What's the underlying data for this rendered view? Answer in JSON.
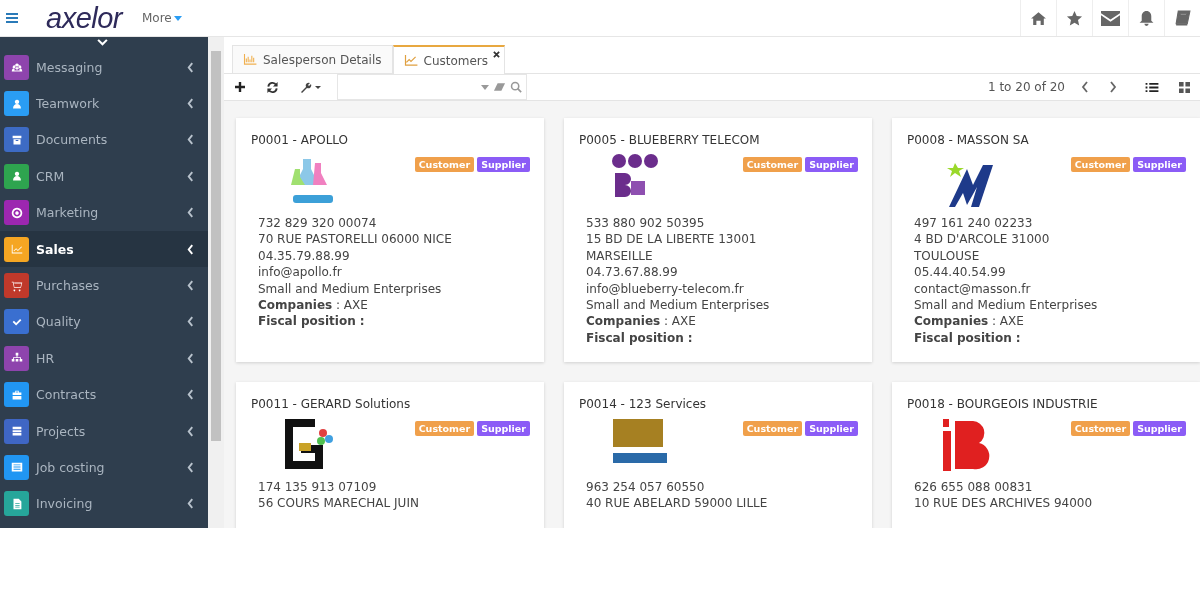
{
  "header": {
    "logo": "axelor",
    "more_menu": "More"
  },
  "sidebar": {
    "items": [
      {
        "label": "Messaging",
        "color": "#8e44ad",
        "selected": false
      },
      {
        "label": "Teamwork",
        "color": "#2a9df4",
        "selected": false
      },
      {
        "label": "Documents",
        "color": "#3d6bc4",
        "selected": false
      },
      {
        "label": "CRM",
        "color": "#2ea44f",
        "selected": false
      },
      {
        "label": "Marketing",
        "color": "#9c27b0",
        "selected": false
      },
      {
        "label": "Sales",
        "color": "#f5a623",
        "selected": true
      },
      {
        "label": "Purchases",
        "color": "#c0392b",
        "selected": false
      },
      {
        "label": "Quality",
        "color": "#3a6fd0",
        "selected": false
      },
      {
        "label": "HR",
        "color": "#8e44ad",
        "selected": false
      },
      {
        "label": "Contracts",
        "color": "#2196f3",
        "selected": false
      },
      {
        "label": "Projects",
        "color": "#3f66c4",
        "selected": false
      },
      {
        "label": "Job costing",
        "color": "#2196f3",
        "selected": false
      },
      {
        "label": "Invoicing",
        "color": "#26a69a",
        "selected": false
      }
    ]
  },
  "tabs": [
    {
      "label": "Salesperson Details",
      "selected": false
    },
    {
      "label": "Customers",
      "selected": true
    }
  ],
  "toolbar": {
    "pager": "1 to 20 of 20"
  },
  "cards": [
    {
      "title": "P0001 - APOLLO",
      "tags": [
        {
          "label": "Customer",
          "color": "#f0a04b"
        },
        {
          "label": "Supplier",
          "color": "#8b5cf6"
        }
      ],
      "lines": [
        "732 829 320 00074",
        "70 RUE PASTORELLI 06000 NICE",
        "04.35.79.88.99",
        "info@apollo.fr",
        "Small and Medium Enterprises",
        "**Companies** : AXE",
        "**Fiscal position :**"
      ]
    },
    {
      "title": "P0005 - BLUEBERRY TELECOM",
      "tags": [
        {
          "label": "Customer",
          "color": "#f0a04b"
        },
        {
          "label": "Supplier",
          "color": "#8b5cf6"
        }
      ],
      "lines": [
        "533 880 902 50395",
        "15 BD DE LA LIBERTE 13001",
        "MARSEILLE",
        "04.73.67.88.99",
        "info@blueberry-telecom.fr",
        "Small and Medium Enterprises",
        "**Companies** : AXE",
        "**Fiscal position :**"
      ]
    },
    {
      "title": "P0008 - MASSON SA",
      "tags": [
        {
          "label": "Customer",
          "color": "#f0a04b"
        },
        {
          "label": "Supplier",
          "color": "#8b5cf6"
        }
      ],
      "lines": [
        "497 161 240 02233",
        "4 BD D'ARCOLE 31000",
        "TOULOUSE",
        "05.44.40.54.99",
        "contact@masson.fr",
        "Small and Medium Enterprises",
        "**Companies** : AXE",
        "**Fiscal position :**"
      ]
    },
    {
      "title": "P0011 - GERARD Solutions",
      "tags": [
        {
          "label": "Customer",
          "color": "#f0a04b"
        },
        {
          "label": "Supplier",
          "color": "#8b5cf6"
        }
      ],
      "lines": [
        "174 135 913 07109",
        "56 COURS MARECHAL JUIN"
      ]
    },
    {
      "title": "P0014 - 123 Services",
      "tags": [
        {
          "label": "Customer",
          "color": "#f0a04b"
        },
        {
          "label": "Supplier",
          "color": "#8b5cf6"
        }
      ],
      "lines": [
        "963 254 057 60550",
        "40 RUE ABELARD 59000 LILLE"
      ]
    },
    {
      "title": "P0018 - BOURGEOIS INDUSTRIE",
      "tags": [
        {
          "label": "Customer",
          "color": "#f0a04b"
        },
        {
          "label": "Supplier",
          "color": "#8b5cf6"
        }
      ],
      "lines": [
        "626 655 088 00831",
        "10 RUE DES ARCHIVES 94000"
      ]
    }
  ]
}
